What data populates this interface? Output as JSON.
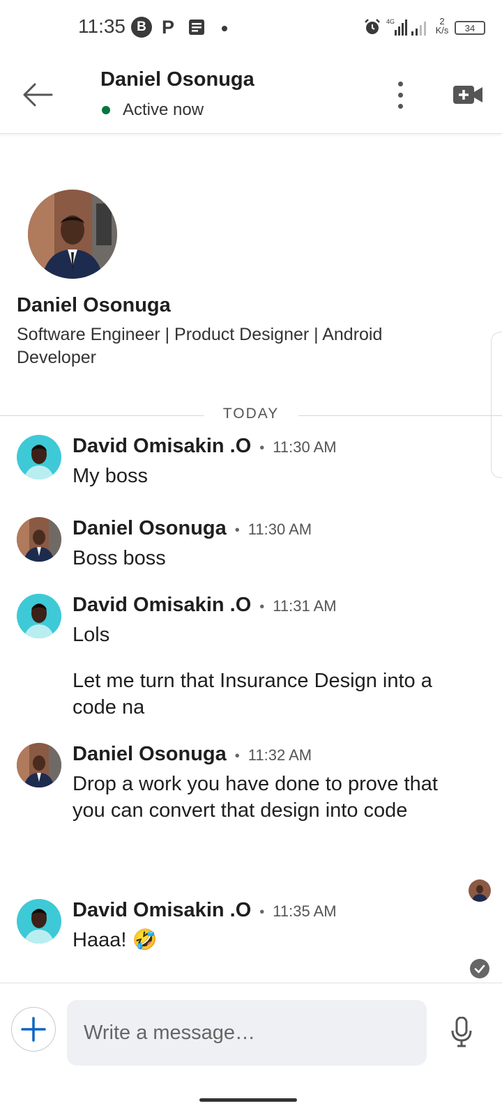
{
  "status_bar": {
    "time": "11:35",
    "b_label": "B",
    "p_label": "P",
    "network": "4G",
    "speed_value": "2",
    "speed_unit": "K/s",
    "battery": "34"
  },
  "header": {
    "contact_name": "Daniel Osonuga",
    "presence": "Active now",
    "presence_color": "#057642"
  },
  "profile": {
    "name": "Daniel Osonuga",
    "headline": "Software Engineer | Product Designer | Android Developer"
  },
  "day_divider": "TODAY",
  "messages": [
    {
      "sender": "David Omisakin .O",
      "separator": "•",
      "time": "11:30 AM",
      "lines": [
        "My boss"
      ]
    },
    {
      "sender": "Daniel Osonuga",
      "separator": "•",
      "time": "11:30 AM",
      "lines": [
        "Boss boss"
      ]
    },
    {
      "sender": "David Omisakin .O",
      "separator": "•",
      "time": "11:31 AM",
      "lines": [
        "Lols",
        "Let me turn that Insurance Design into a code na"
      ]
    },
    {
      "sender": "Daniel Osonuga",
      "separator": "•",
      "time": "11:32 AM",
      "lines": [
        "Drop a work you have done to prove that you can convert that design into code"
      ]
    },
    {
      "sender": "David Omisakin .O",
      "separator": "•",
      "time": "11:35 AM",
      "lines": [
        "Haaa! 🤣"
      ]
    }
  ],
  "composer": {
    "placeholder": "Write a message…"
  },
  "colors": {
    "accent": "#0a66c2",
    "text": "#1f1f1f",
    "input_bg": "#eef0f3"
  }
}
